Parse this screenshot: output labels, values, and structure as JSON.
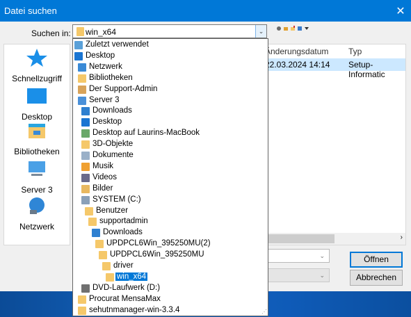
{
  "window": {
    "title": "Datei suchen",
    "close_glyph": "✕"
  },
  "look_in": {
    "label": "Suchen in:",
    "value": "win_x64",
    "arrow": "⌄"
  },
  "toolbar": {
    "icons": [
      "back-icon",
      "up-folder-icon",
      "new-folder-icon",
      "view-menu-icon"
    ]
  },
  "places": [
    {
      "label": "Schnellzugriff",
      "icon": "star-icon"
    },
    {
      "label": "Desktop",
      "icon": "desktop-icon"
    },
    {
      "label": "Bibliotheken",
      "icon": "libraries-icon"
    },
    {
      "label": "Server 3",
      "icon": "computer-icon"
    },
    {
      "label": "Netzwerk",
      "icon": "network-icon"
    }
  ],
  "filelist": {
    "headers": {
      "date": "Änderungsdatum",
      "type": "Typ"
    },
    "row": {
      "date": "22.03.2024 14:14",
      "type": "Setup-Informatic"
    }
  },
  "buttons": {
    "open": "Öffnen",
    "cancel": "Abbrechen"
  },
  "dropdown_items": [
    {
      "label": "Zuletzt verwendet",
      "indent": 0,
      "color": "#5aa0d8"
    },
    {
      "label": "Desktop",
      "indent": 0,
      "color": "#1a75d2"
    },
    {
      "label": "Netzwerk",
      "indent": 1,
      "color": "#3a8ad6"
    },
    {
      "label": "Bibliotheken",
      "indent": 1,
      "color": "#f5c86a"
    },
    {
      "label": "Der Support-Admin",
      "indent": 1,
      "color": "#d8a35a"
    },
    {
      "label": "Server 3",
      "indent": 1,
      "color": "#4a90d9"
    },
    {
      "label": "Downloads",
      "indent": 2,
      "color": "#2f80d0"
    },
    {
      "label": "Desktop",
      "indent": 2,
      "color": "#1a75d2"
    },
    {
      "label": "Desktop auf Laurins-MacBook",
      "indent": 2,
      "color": "#6aa86a"
    },
    {
      "label": "3D-Objekte",
      "indent": 2,
      "color": "#f5c86a"
    },
    {
      "label": "Dokumente",
      "indent": 2,
      "color": "#9ab0c8"
    },
    {
      "label": "Musik",
      "indent": 2,
      "color": "#f0a030"
    },
    {
      "label": "Videos",
      "indent": 2,
      "color": "#6a6a8a"
    },
    {
      "label": "Bilder",
      "indent": 2,
      "color": "#e8b860"
    },
    {
      "label": "SYSTEM (C:)",
      "indent": 2,
      "color": "#8aa0b8"
    },
    {
      "label": "Benutzer",
      "indent": 3,
      "color": "#f5c86a"
    },
    {
      "label": "supportadmin",
      "indent": 4,
      "color": "#f5c86a"
    },
    {
      "label": "Downloads",
      "indent": 5,
      "color": "#2f80d0"
    },
    {
      "label": "UPDPCL6Win_395250MU(2)",
      "indent": 6,
      "color": "#f5c86a"
    },
    {
      "label": "UPDPCL6Win_395250MU",
      "indent": 7,
      "color": "#f5c86a"
    },
    {
      "label": "driver",
      "indent": 8,
      "color": "#f5c86a"
    },
    {
      "label": "win_x64",
      "indent": 9,
      "color": "#f5c86a",
      "selected": true
    },
    {
      "label": "DVD-Laufwerk (D:)",
      "indent": 2,
      "color": "#707070"
    },
    {
      "label": "Procurat MensaMax",
      "indent": 1,
      "color": "#f5c86a"
    },
    {
      "label": "sehutnmanager-win-3.3.4",
      "indent": 1,
      "color": "#f5c86a"
    }
  ],
  "colors": {
    "accent": "#0078d7",
    "selection": "#cce8ff"
  }
}
